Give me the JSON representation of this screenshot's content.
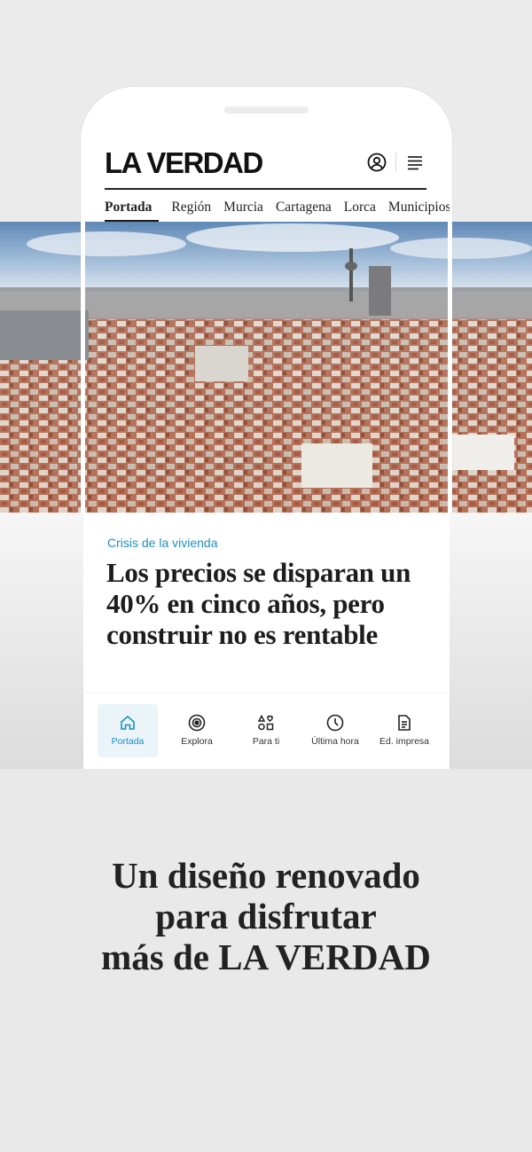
{
  "header": {
    "logo": "LA VERDAD",
    "account_icon": "user-circle-icon",
    "menu_icon": "hamburger-menu-icon"
  },
  "tabs": [
    {
      "label": "Portada",
      "active": true
    },
    {
      "label": "Región",
      "active": false
    },
    {
      "label": "Murcia",
      "active": false
    },
    {
      "label": "Cartagena",
      "active": false
    },
    {
      "label": "Lorca",
      "active": false
    },
    {
      "label": "Municipios",
      "active": false
    }
  ],
  "article": {
    "kicker": "Crisis de la vivienda",
    "headline": "Los precios se disparan un 40% en cinco años, pero construir no es rentable"
  },
  "bottom_nav": [
    {
      "label": "Portada",
      "icon": "home-icon",
      "active": true
    },
    {
      "label": "Explora",
      "icon": "target-icon",
      "active": false
    },
    {
      "label": "Para ti",
      "icon": "shapes-heart-icon",
      "active": false
    },
    {
      "label": "Última hora",
      "icon": "clock-icon",
      "active": false
    },
    {
      "label": "Ed. impresa",
      "icon": "document-icon",
      "active": false
    }
  ],
  "tagline": {
    "line1": "Un diseño renovado",
    "line2": "para disfrutar",
    "line3": "más de LA VERDAD"
  },
  "colors": {
    "accent": "#1c8fc2",
    "text": "#1d1d1d",
    "background": "#e9e9e9"
  }
}
